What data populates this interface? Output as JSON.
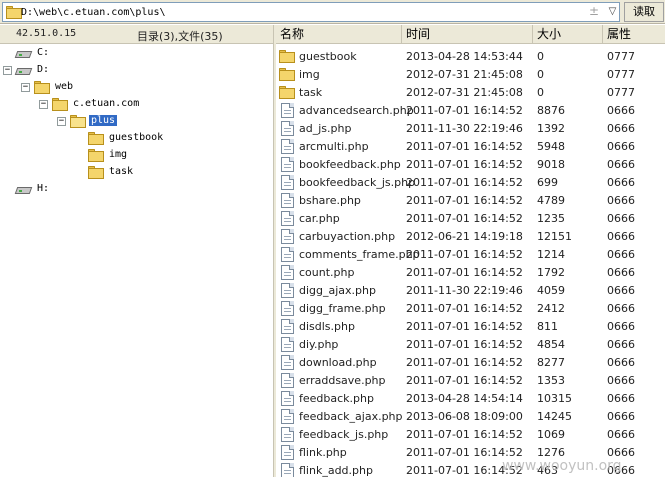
{
  "address_bar": {
    "path": "D:\\web\\c.etuan.com\\plus\\",
    "pm_symbol": "±",
    "dropdown_symbol": "▽",
    "read_label": "读取"
  },
  "left_panel": {
    "ip": "42.51.0.15",
    "count": "目录(3),文件(35)"
  },
  "tree": [
    {
      "label": "C:",
      "type": "drive",
      "level": 0,
      "expander": ""
    },
    {
      "label": "D:",
      "type": "drive",
      "level": 0,
      "expander": "−"
    },
    {
      "label": "web",
      "type": "folder",
      "level": 1,
      "expander": "−"
    },
    {
      "label": "c.etuan.com",
      "type": "folder",
      "level": 2,
      "expander": "−"
    },
    {
      "label": "plus",
      "type": "folder",
      "level": 3,
      "expander": "−",
      "selected": true
    },
    {
      "label": "guestbook",
      "type": "folder",
      "level": 4,
      "expander": ""
    },
    {
      "label": "img",
      "type": "folder",
      "level": 4,
      "expander": ""
    },
    {
      "label": "task",
      "type": "folder",
      "level": 4,
      "expander": ""
    },
    {
      "label": "H:",
      "type": "drive",
      "level": 0,
      "expander": ""
    }
  ],
  "columns": {
    "name": "名称",
    "time": "时间",
    "size": "大小",
    "attr": "属性"
  },
  "files": [
    {
      "name": "guestbook",
      "time": "2013-04-28 14:53:44",
      "size": "0",
      "attr": "0777",
      "type": "folder"
    },
    {
      "name": "img",
      "time": "2012-07-31 21:45:08",
      "size": "0",
      "attr": "0777",
      "type": "folder"
    },
    {
      "name": "task",
      "time": "2012-07-31 21:45:08",
      "size": "0",
      "attr": "0777",
      "type": "folder"
    },
    {
      "name": "advancedsearch.php",
      "time": "2011-07-01 16:14:52",
      "size": "8876",
      "attr": "0666",
      "type": "file"
    },
    {
      "name": "ad_js.php",
      "time": "2011-11-30 22:19:46",
      "size": "1392",
      "attr": "0666",
      "type": "file"
    },
    {
      "name": "arcmulti.php",
      "time": "2011-07-01 16:14:52",
      "size": "5948",
      "attr": "0666",
      "type": "file"
    },
    {
      "name": "bookfeedback.php",
      "time": "2011-07-01 16:14:52",
      "size": "9018",
      "attr": "0666",
      "type": "file"
    },
    {
      "name": "bookfeedback_js.php",
      "time": "2011-07-01 16:14:52",
      "size": "699",
      "attr": "0666",
      "type": "file"
    },
    {
      "name": "bshare.php",
      "time": "2011-07-01 16:14:52",
      "size": "4789",
      "attr": "0666",
      "type": "file"
    },
    {
      "name": "car.php",
      "time": "2011-07-01 16:14:52",
      "size": "1235",
      "attr": "0666",
      "type": "file"
    },
    {
      "name": "carbuyaction.php",
      "time": "2012-06-21 14:19:18",
      "size": "12151",
      "attr": "0666",
      "type": "file"
    },
    {
      "name": "comments_frame.php",
      "time": "2011-07-01 16:14:52",
      "size": "1214",
      "attr": "0666",
      "type": "file"
    },
    {
      "name": "count.php",
      "time": "2011-07-01 16:14:52",
      "size": "1792",
      "attr": "0666",
      "type": "file"
    },
    {
      "name": "digg_ajax.php",
      "time": "2011-11-30 22:19:46",
      "size": "4059",
      "attr": "0666",
      "type": "file"
    },
    {
      "name": "digg_frame.php",
      "time": "2011-07-01 16:14:52",
      "size": "2412",
      "attr": "0666",
      "type": "file"
    },
    {
      "name": "disdls.php",
      "time": "2011-07-01 16:14:52",
      "size": "811",
      "attr": "0666",
      "type": "file"
    },
    {
      "name": "diy.php",
      "time": "2011-07-01 16:14:52",
      "size": "4854",
      "attr": "0666",
      "type": "file"
    },
    {
      "name": "download.php",
      "time": "2011-07-01 16:14:52",
      "size": "8277",
      "attr": "0666",
      "type": "file"
    },
    {
      "name": "erraddsave.php",
      "time": "2011-07-01 16:14:52",
      "size": "1353",
      "attr": "0666",
      "type": "file"
    },
    {
      "name": "feedback.php",
      "time": "2013-04-28 14:54:14",
      "size": "10315",
      "attr": "0666",
      "type": "file"
    },
    {
      "name": "feedback_ajax.php",
      "time": "2013-06-08 18:09:00",
      "size": "14245",
      "attr": "0666",
      "type": "file"
    },
    {
      "name": "feedback_js.php",
      "time": "2011-07-01 16:14:52",
      "size": "1069",
      "attr": "0666",
      "type": "file"
    },
    {
      "name": "flink.php",
      "time": "2011-07-01 16:14:52",
      "size": "1276",
      "attr": "0666",
      "type": "file"
    },
    {
      "name": "flink_add.php",
      "time": "2011-07-01 16:14:52",
      "size": "463",
      "attr": "0666",
      "type": "file"
    }
  ],
  "watermark": "www.wooyun.org"
}
